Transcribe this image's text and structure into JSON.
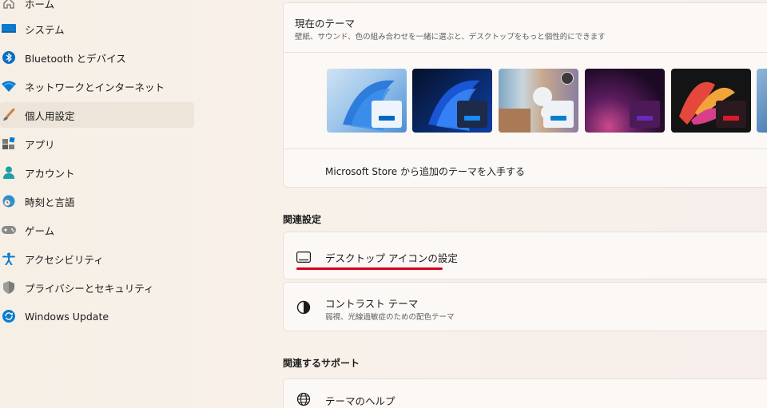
{
  "sidebar": {
    "items": [
      {
        "label": "ホーム",
        "icon": "home-icon"
      },
      {
        "label": "システム",
        "icon": "system-icon"
      },
      {
        "label": "Bluetooth とデバイス",
        "icon": "bluetooth-icon"
      },
      {
        "label": "ネットワークとインターネット",
        "icon": "wifi-icon"
      },
      {
        "label": "個人用設定",
        "icon": "brush-icon",
        "selected": true
      },
      {
        "label": "アプリ",
        "icon": "apps-icon"
      },
      {
        "label": "アカウント",
        "icon": "account-icon"
      },
      {
        "label": "時刻と言語",
        "icon": "globe-clock-icon"
      },
      {
        "label": "ゲーム",
        "icon": "gamepad-icon"
      },
      {
        "label": "アクセシビリティ",
        "icon": "accessibility-icon"
      },
      {
        "label": "プライバシーとセキュリティ",
        "icon": "shield-icon"
      },
      {
        "label": "Windows Update",
        "icon": "update-icon"
      }
    ]
  },
  "current_theme": {
    "title": "現在のテーマ",
    "subtitle": "壁紙、サウンド、色の組み合わせを一緒に選ぶと、デスクトップをもっと個性的にできます",
    "store_link": "Microsoft Store から追加のテーマを入手する"
  },
  "related_settings": {
    "heading": "関連設定",
    "desktop_icons": "デスクトップ アイコンの設定",
    "contrast_title": "コントラスト テーマ",
    "contrast_sub": "弱視、光線過敏症のための配色テーマ"
  },
  "related_support": {
    "heading": "関連するサポート",
    "help": "テーマのヘルプ"
  },
  "colors": {
    "accent_blue": "#0067c0",
    "highlight_red": "#d6001c"
  }
}
